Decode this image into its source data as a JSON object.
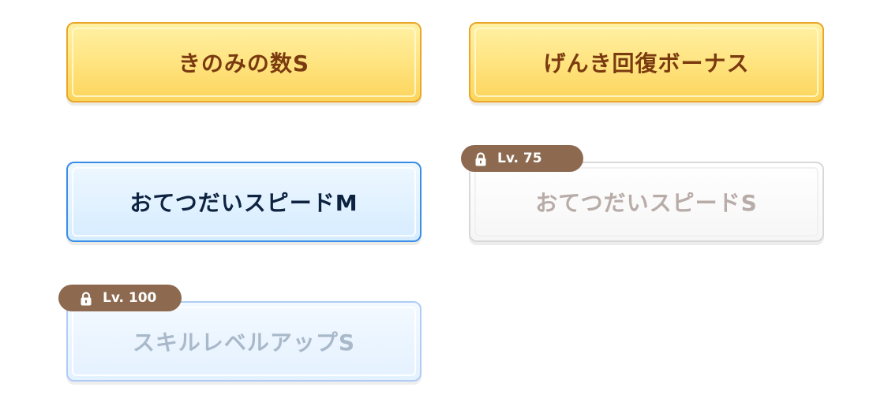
{
  "buttons": [
    {
      "label": "きのみの数S",
      "style": "gold",
      "locked": false
    },
    {
      "label": "げんき回復ボーナス",
      "style": "gold",
      "locked": false
    },
    {
      "label": "おてつだいスピードM",
      "style": "blue",
      "selected": true,
      "locked": false
    },
    {
      "label": "おてつだいスピードS",
      "style": "gray",
      "locked": true,
      "badge": "Lv. 75",
      "badge_icon": "lock-icon"
    },
    {
      "label": "スキルレベルアップS",
      "style": "lightblue",
      "locked": true,
      "badge": "Lv. 100",
      "badge_icon": "lock-icon"
    }
  ],
  "colors": {
    "gold_fill": "#ffe584",
    "gold_border": "#e9a62a",
    "gold_text": "#7a3a10",
    "blue_fill": "#d6ecff",
    "blue_border": "#3a8ee6",
    "blue_text": "#0e2340",
    "locked_gray_text": "#b8aca8",
    "locked_blue_text": "#a9b9c9",
    "badge_bg": "#8d6a4f"
  }
}
